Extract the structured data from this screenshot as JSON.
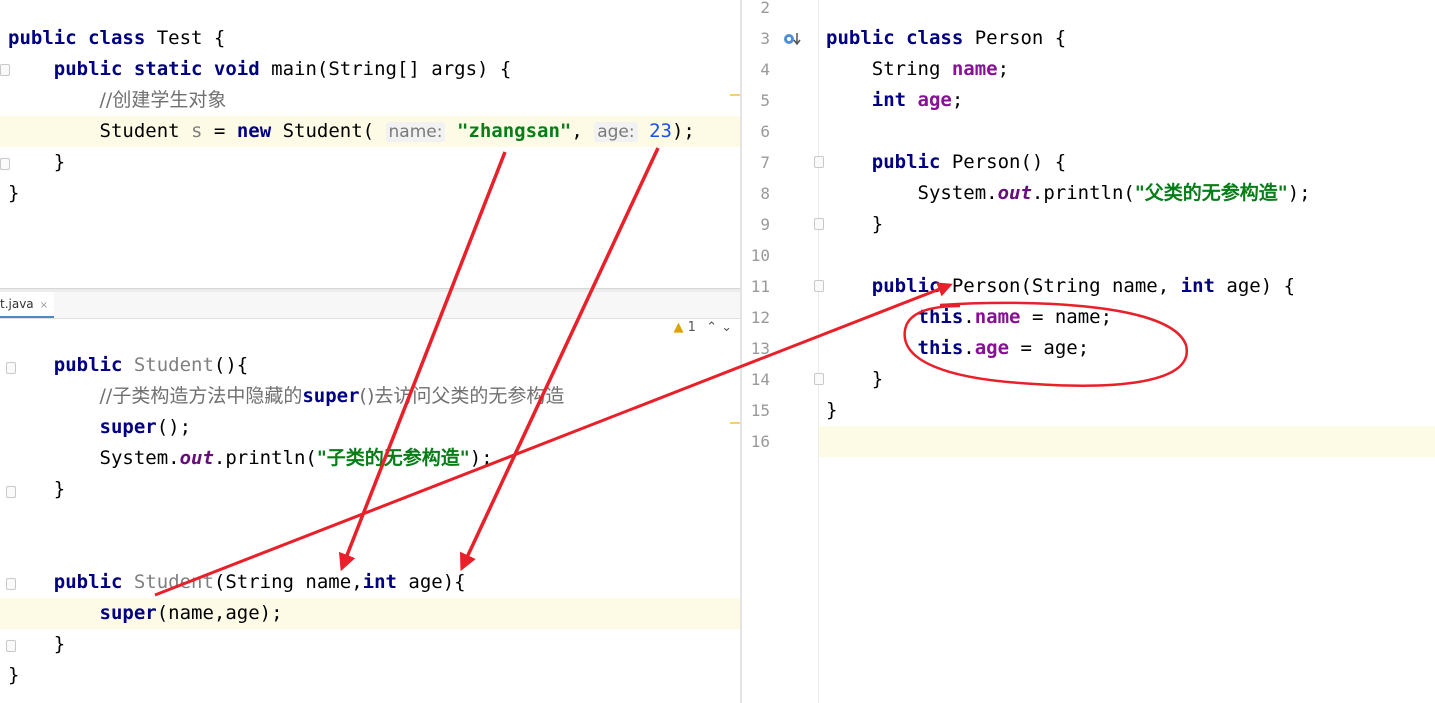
{
  "test_pane": {
    "lines": [
      {
        "parts": [
          [
            "kw",
            "public "
          ],
          [
            "kw",
            "class "
          ],
          [
            "",
            "Test {"
          ]
        ]
      },
      {
        "parts": [
          [
            "",
            "    "
          ],
          [
            "kw",
            "public "
          ],
          [
            "kw",
            "static "
          ],
          [
            "kw",
            "void "
          ],
          [
            "",
            "main(String[] args) {"
          ]
        ]
      },
      {
        "parts": [
          [
            "",
            "        "
          ],
          [
            "cn-comment",
            "//创建学生对象"
          ]
        ]
      },
      {
        "parts": [
          [
            "",
            "        Student "
          ],
          [
            "unused",
            "s"
          ],
          [
            "",
            " = "
          ],
          [
            "kw",
            "new "
          ],
          [
            "",
            "Student( "
          ],
          [
            "hint",
            "name:"
          ],
          [
            "",
            " "
          ],
          [
            "str",
            "\"zhangsan\""
          ],
          [
            "",
            ", "
          ],
          [
            "hint",
            "age:"
          ],
          [
            "",
            " "
          ],
          [
            "num",
            "23"
          ],
          [
            "",
            ");"
          ]
        ]
      },
      {
        "parts": [
          [
            "",
            "    }"
          ]
        ]
      },
      {
        "parts": [
          [
            "",
            "}"
          ]
        ]
      }
    ]
  },
  "student_pane": {
    "tab_label": "t.java",
    "tab_close": "×",
    "warning_count": "1",
    "warning_arrows": "⌃ ⌄",
    "lines": [
      {
        "parts": [
          [
            "",
            "    "
          ],
          [
            "kw",
            "public "
          ],
          [
            "unused",
            "Student"
          ],
          [
            "",
            "(){"
          ]
        ]
      },
      {
        "parts": [
          [
            "",
            "        "
          ],
          [
            "cn-comment",
            "//子类构造方法中隐藏的"
          ],
          [
            "kw",
            "super"
          ],
          [
            "cn-comment",
            "()去访问父类的无参构造"
          ]
        ]
      },
      {
        "parts": [
          [
            "",
            "        "
          ],
          [
            "kw",
            "super"
          ],
          [
            "",
            "();"
          ]
        ]
      },
      {
        "parts": [
          [
            "",
            "        System."
          ],
          [
            "st",
            "out"
          ],
          [
            "",
            ".println("
          ],
          [
            "cn-str",
            "\"子类的无参构造\""
          ],
          [
            "",
            ");"
          ]
        ]
      },
      {
        "parts": [
          [
            "",
            "    }"
          ]
        ]
      },
      {
        "parts": [
          [
            "",
            ""
          ]
        ]
      },
      {
        "parts": [
          [
            "",
            ""
          ]
        ]
      },
      {
        "parts": [
          [
            "",
            "    "
          ],
          [
            "kw",
            "public "
          ],
          [
            "unused",
            "Student"
          ],
          [
            "",
            "(String name,"
          ],
          [
            "kw",
            "int "
          ],
          [
            "",
            "age){"
          ]
        ]
      },
      {
        "parts": [
          [
            "",
            "        "
          ],
          [
            "kw",
            "super"
          ],
          [
            "",
            "(name,age);"
          ]
        ]
      },
      {
        "parts": [
          [
            "",
            "    }"
          ]
        ]
      },
      {
        "parts": [
          [
            "",
            "}"
          ]
        ]
      }
    ]
  },
  "person_pane": {
    "line_numbers": [
      "2",
      "3",
      "4",
      "5",
      "6",
      "7",
      "8",
      "9",
      "10",
      "11",
      "12",
      "13",
      "14",
      "15",
      "16"
    ],
    "lines": [
      {
        "parts": [
          [
            "",
            ""
          ]
        ]
      },
      {
        "parts": [
          [
            "kw",
            "public "
          ],
          [
            "kw",
            "class "
          ],
          [
            "",
            "Person {"
          ]
        ]
      },
      {
        "parts": [
          [
            "",
            "    String "
          ],
          [
            "fld",
            "name"
          ],
          [
            "",
            ";"
          ]
        ]
      },
      {
        "parts": [
          [
            "",
            "    "
          ],
          [
            "kw",
            "int "
          ],
          [
            "fld",
            "age"
          ],
          [
            "",
            ";"
          ]
        ]
      },
      {
        "parts": [
          [
            "",
            ""
          ]
        ]
      },
      {
        "parts": [
          [
            "",
            "    "
          ],
          [
            "kw",
            "public "
          ],
          [
            "",
            "Person() {"
          ]
        ]
      },
      {
        "parts": [
          [
            "",
            "        System."
          ],
          [
            "st",
            "out"
          ],
          [
            "",
            ".println("
          ],
          [
            "cn-str",
            "\"父类的无参构造\""
          ],
          [
            "",
            ");"
          ]
        ]
      },
      {
        "parts": [
          [
            "",
            "    }"
          ]
        ]
      },
      {
        "parts": [
          [
            "",
            ""
          ]
        ]
      },
      {
        "parts": [
          [
            "",
            "    "
          ],
          [
            "kw",
            "public "
          ],
          [
            "",
            "Person(String name, "
          ],
          [
            "kw",
            "int "
          ],
          [
            "",
            "age) {"
          ]
        ]
      },
      {
        "parts": [
          [
            "",
            "        "
          ],
          [
            "kw",
            "this"
          ],
          [
            "",
            "."
          ],
          [
            "fld",
            "name"
          ],
          [
            "",
            " = name;"
          ]
        ]
      },
      {
        "parts": [
          [
            "",
            "        "
          ],
          [
            "kw",
            "this"
          ],
          [
            "",
            "."
          ],
          [
            "fld",
            "age"
          ],
          [
            "",
            " = age;"
          ]
        ]
      },
      {
        "parts": [
          [
            "",
            "    }"
          ]
        ]
      },
      {
        "parts": [
          [
            "",
            "}"
          ]
        ]
      },
      {
        "parts": [
          [
            "",
            ""
          ]
        ]
      }
    ]
  },
  "colors": {
    "annotation": "#e8202a",
    "keyword": "#000080",
    "string": "#067d17",
    "field": "#871094"
  }
}
